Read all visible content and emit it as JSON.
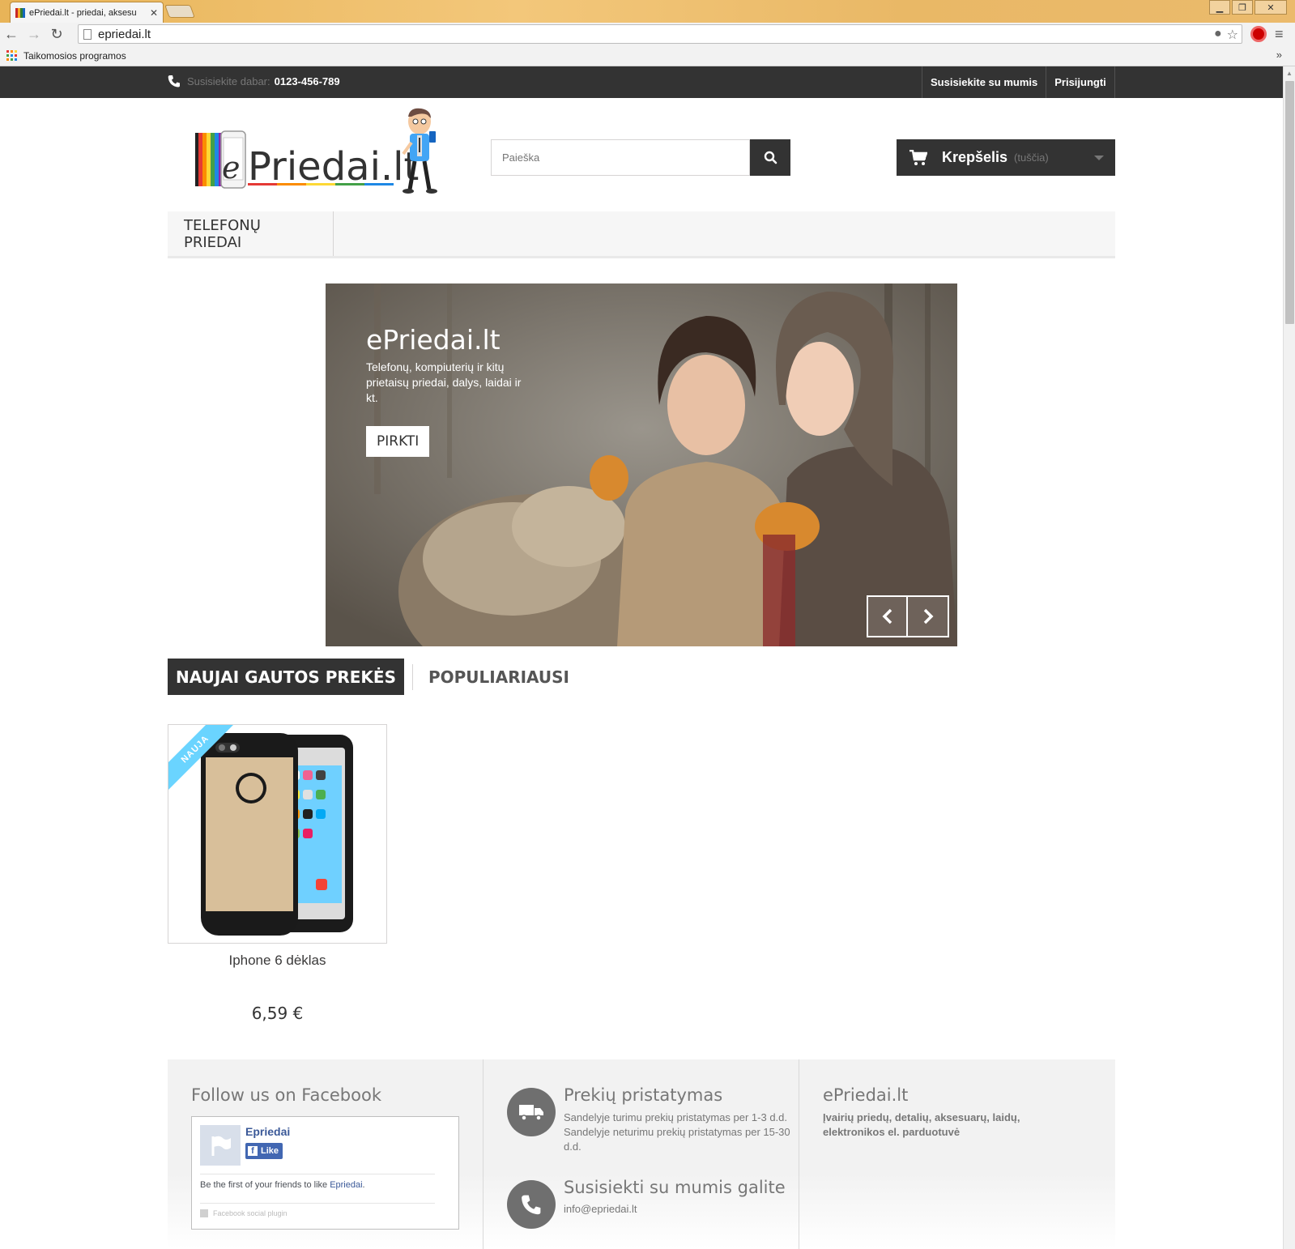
{
  "browser": {
    "tab_title": "ePriedai.lt - priedai, aksesu",
    "tab_close": "✕",
    "url": "epriedai.lt",
    "bookmark_apps": "Taikomosios programos",
    "bookmarks_more": "»",
    "window_min": "▁",
    "window_restore": "❐",
    "window_close": "✕"
  },
  "topbar": {
    "contact_label": "Susisiekite dabar:",
    "contact_phone": "0123-456-789",
    "links": [
      "Susisiekite su mumis",
      "Prisijungti"
    ]
  },
  "header": {
    "logo_text": "ePriedai.lt",
    "search_placeholder": "Paieška",
    "cart_title": "Krepšelis",
    "cart_status": "(tuščia)"
  },
  "menu": {
    "items": [
      "TELEFONŲ PRIEDAI"
    ]
  },
  "slider": {
    "title": "ePriedai.lt",
    "text": "Telefonų, kompiuterių ir kitų prietaisų priedai, dalys, laidai ir kt.",
    "button": "PIRKTI"
  },
  "product_tabs": {
    "active": "NAUJAI GAUTOS PREKĖS",
    "inactive": "POPULIARIAUSI"
  },
  "products": [
    {
      "badge": "NAUJA",
      "name": "Iphone 6 dėklas",
      "price": "6,59 €"
    }
  ],
  "footer": {
    "facebook": {
      "title": "Follow us on Facebook",
      "page_name": "Epriedai",
      "like": "Like",
      "friends_text": "Be the first of your friends to like ",
      "friends_link": "Epriedai",
      "friends_end": ".",
      "social_plugin": "Facebook social plugin"
    },
    "delivery": {
      "title": "Prekių pristatymas",
      "text": "Sandelyje turimu prekių pristatymas per 1-3 d.d. Sandelyje neturimu prekių pristatymas per 15-30 d.d."
    },
    "contact": {
      "title": "Susisiekti su mumis galite",
      "email": "info@epriedai.lt"
    },
    "about": {
      "title": "ePriedai.lt",
      "text": "Įvairių priedų, detalių, aksesuarų, laidų, elektronikos el. parduotuvė"
    }
  },
  "colors": {
    "dark": "#333333",
    "ribbon": "#6ad4ff",
    "facebook": "#4267b2"
  }
}
